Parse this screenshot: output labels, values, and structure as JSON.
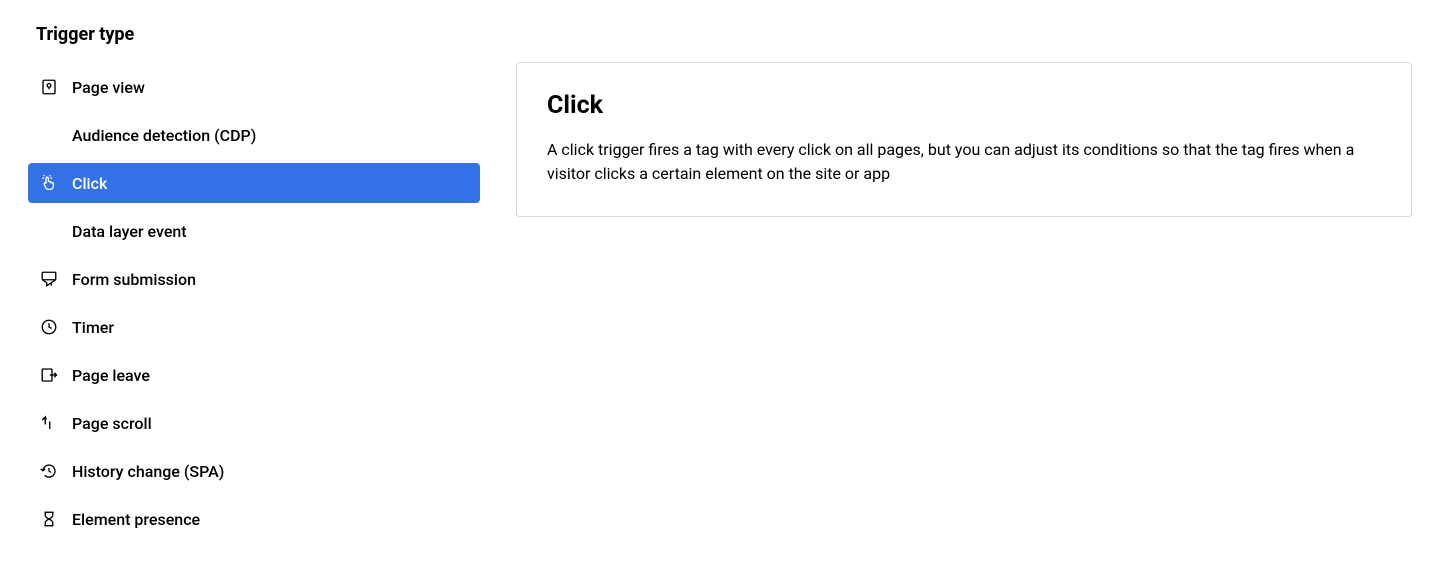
{
  "section_title": "Trigger type",
  "triggers": [
    {
      "icon": "page-view-icon",
      "label": "Page view",
      "selected": false
    },
    {
      "icon": "audience-icon",
      "label": "Audience detection (CDP)",
      "selected": false
    },
    {
      "icon": "click-icon",
      "label": "Click",
      "selected": true
    },
    {
      "icon": "layers-icon",
      "label": "Data layer event",
      "selected": false
    },
    {
      "icon": "form-icon",
      "label": "Form submission",
      "selected": false
    },
    {
      "icon": "timer-icon",
      "label": "Timer",
      "selected": false
    },
    {
      "icon": "page-leave-icon",
      "label": "Page leave",
      "selected": false
    },
    {
      "icon": "scroll-icon",
      "label": "Page scroll",
      "selected": false
    },
    {
      "icon": "history-icon",
      "label": "History change (SPA)",
      "selected": false
    },
    {
      "icon": "hourglass-icon",
      "label": "Element presence",
      "selected": false
    }
  ],
  "detail": {
    "title": "Click",
    "description": "A click trigger fires a tag with every click on all pages, but you can adjust its conditions so that the tag fires when a visitor clicks a certain element on the site or app"
  }
}
